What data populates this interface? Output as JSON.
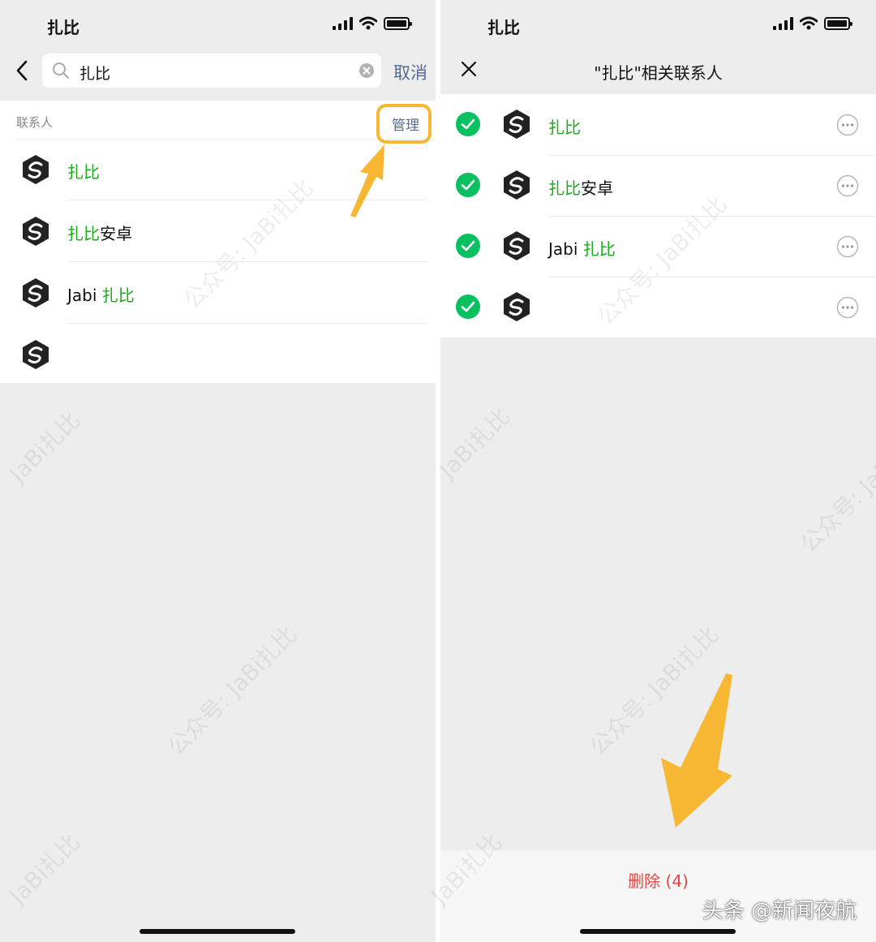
{
  "left_screen": {
    "status_title": "扎比",
    "search": {
      "value": "扎比"
    },
    "cancel_label": "取消",
    "section_label": "联系人",
    "manage_label": "管理",
    "contacts": [
      {
        "prefix": "",
        "highlight": "扎比",
        "suffix": ""
      },
      {
        "prefix": "",
        "highlight": "扎比",
        "suffix": "安卓"
      },
      {
        "prefix": "Jabi ",
        "highlight": "扎比",
        "suffix": ""
      },
      {
        "prefix": "",
        "highlight": "",
        "suffix": ""
      }
    ]
  },
  "right_screen": {
    "status_title": "扎比",
    "title": "\"扎比\"相关联系人",
    "contacts": [
      {
        "prefix": "",
        "highlight": "扎比",
        "suffix": "",
        "checked": true
      },
      {
        "prefix": "",
        "highlight": "扎比",
        "suffix": "安卓",
        "checked": true
      },
      {
        "prefix": "Jabi ",
        "highlight": "扎比",
        "suffix": "",
        "checked": true
      },
      {
        "prefix": "",
        "highlight": "",
        "suffix": "",
        "checked": true
      }
    ],
    "delete_label": "删除 (4)"
  },
  "watermarks": {
    "brand": "JaBi扎比",
    "account": "公众号: JaBi扎比"
  },
  "source_tag": "头条 @新闻夜航",
  "icons": {
    "back": "chevron-left-icon",
    "search": "search-icon",
    "clear": "clear-icon",
    "close": "close-icon",
    "check": "check-circle-icon",
    "more": "more-icon",
    "signal": "signal-icon",
    "wifi": "wifi-icon",
    "battery": "battery-icon"
  },
  "colors": {
    "highlight_green": "#1aad19",
    "link_blue": "#576b95",
    "delete_red": "#e64340",
    "annotation_orange": "#f7b733",
    "background": "#ededed"
  }
}
